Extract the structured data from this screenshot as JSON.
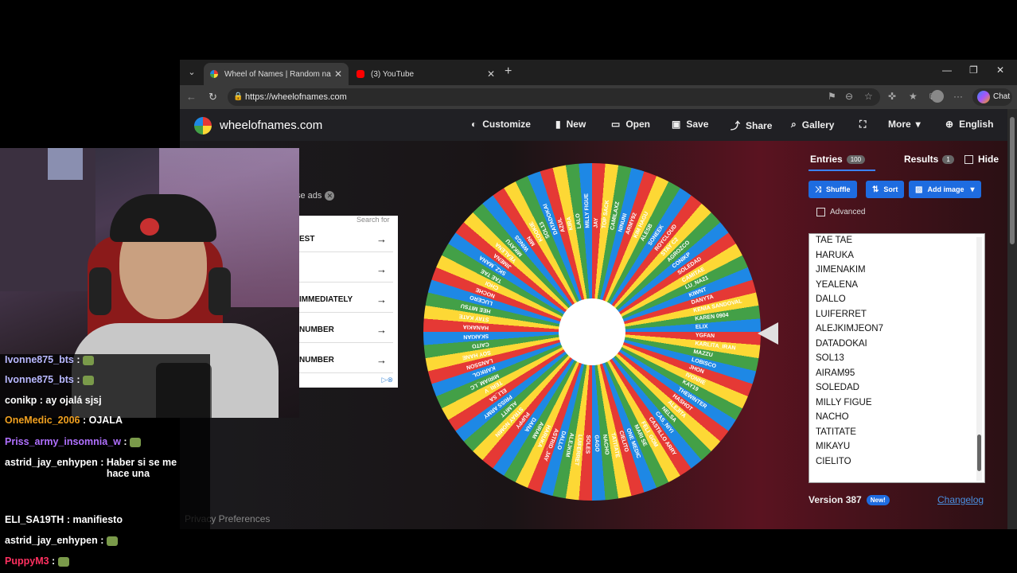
{
  "browser": {
    "tabs": [
      {
        "title": "Wheel of Names | Random name p",
        "favicon": "wheel-favicon",
        "active": true
      },
      {
        "title": "(3) YouTube",
        "favicon": "youtube-favicon",
        "active": false
      }
    ],
    "url": "https://wheelofnames.com",
    "chat_label": "Chat"
  },
  "site": {
    "brand": "wheelofnames.com",
    "menu": [
      {
        "label": "Customize",
        "icon": "palette-icon"
      },
      {
        "label": "New",
        "icon": "file-icon"
      },
      {
        "label": "Open",
        "icon": "folder-icon"
      },
      {
        "label": "Save",
        "icon": "save-icon"
      },
      {
        "label": "Share",
        "icon": "share-icon"
      },
      {
        "label": "Gallery",
        "icon": "search-icon"
      },
      {
        "label": "",
        "icon": "fullscreen-icon"
      },
      {
        "label": "More",
        "icon": "chevron-down-icon"
      },
      {
        "label": "English",
        "icon": "globe-icon"
      }
    ],
    "close_ads": "se ads",
    "ad": {
      "search_for": "Search for",
      "rows": [
        "EST",
        "",
        "IMMEDIATELY",
        "NUMBER",
        "NUMBER"
      ]
    },
    "privacy": "Privacy Preferences"
  },
  "sidebar": {
    "entries_label": "Entries",
    "entries_count": "100",
    "results_label": "Results",
    "results_count": "1",
    "hide_label": "Hide",
    "shuffle_label": "Shuffle",
    "sort_label": "Sort",
    "add_image_label": "Add image",
    "advanced_label": "Advanced",
    "entries": [
      "TAE TAE",
      "HARUKA",
      "JIMENAKIM",
      "YEALENA",
      "DALLO",
      "LUIFERRET",
      "ALEJKIMJEON7",
      "DATADOKAI",
      "SOL13",
      "AIRAM95",
      "SOLEDAD",
      "MILLY FIGUE",
      "NACHO",
      "TATITATE",
      "MIKAYU",
      "CIELITO"
    ],
    "version": "Version 387",
    "new_badge": "New!",
    "changelog": "Changelog"
  },
  "wheel": {
    "colors": [
      "#e53935",
      "#fdd835",
      "#43a047",
      "#1e88e5"
    ],
    "visible_labels": [
      "JAY",
      "TOP SACK",
      "CAMILAXZ",
      "NINUNI",
      "ARMY92",
      "KIM HAGU",
      "ALESB",
      "SONEEK",
      "ROYCLOUD",
      "STAY C2",
      "AGROZCO",
      "CONIKP",
      "SOLEDAD",
      "CAMITAE",
      "LU_NA21",
      "KIWNT",
      "DANYTA",
      "KENIA SANDOVAL",
      "KAREN 0904",
      "ELIX",
      "YGFAN",
      "KARLITA_IRAN",
      "MAZZU",
      "LOBISCO",
      "JHON",
      "IVONNE",
      "KAY19",
      "THEWINTER",
      "HASHOT",
      "ALEJITA",
      "NELSA",
      "CAS_NIYI",
      "CASTILLO ARRY",
      "FELI_GOM",
      "MARI SE",
      "ONE MEDIC",
      "CIELITO",
      "TATITATE",
      "NACHO",
      "GAGO",
      "SOLES",
      "LUIFERRET",
      "ALEJKIM",
      "DALLO",
      "ASTRID_JAY",
      "HARUKA",
      "AIRAM",
      "DANA",
      "PUPPY",
      "STRAY NOMIN",
      "ALMITT",
      "PRISS ARMY",
      "ELI_SA",
      "TERI_V",
      "MIRIAM_LC",
      "KARKOL",
      "LANSSON",
      "SOY HANE",
      "CAITO",
      "SKAKIAN",
      "HANAKIA",
      "STAY KATE",
      "HEE MITSU",
      "LUCERO",
      "NOCHE",
      "CHOI",
      "TAE TAE",
      "SKZ_MANA",
      "JIMENA",
      "YEALENA",
      "MIKAYU",
      "WINGS",
      "MIN",
      "KOOKIE",
      "SOL13",
      "DATADOKAI",
      "AZUL",
      "KIRA",
      "LALO",
      "MILLY FIGUE"
    ]
  },
  "chat": [
    {
      "user": "Ivonne875_bts",
      "text": "",
      "color": "#b8b8ff"
    },
    {
      "user": "Ivonne875_bts",
      "text": "",
      "color": "#b8b8ff"
    },
    {
      "user": "conikp",
      "text": "ay ojalá sjsj",
      "color": "#ffffff"
    },
    {
      "user": "OneMedic_2006",
      "text": "OJALA",
      "color": "#f0a020"
    },
    {
      "user": "Priss_army_insomnia_w",
      "text": "",
      "color": "#b070ff"
    },
    {
      "user": "astrid_jay_enhypen",
      "text": "Haber si se me hace una",
      "color": "#ffffff"
    },
    {
      "user": "ELI_SA19TH",
      "text": "manifiesto",
      "color": "#ffffff"
    },
    {
      "user": "astrid_jay_enhypen",
      "text": "",
      "color": "#ffffff"
    },
    {
      "user": "PuppyM3",
      "text": "",
      "color": "#ff3060"
    }
  ]
}
